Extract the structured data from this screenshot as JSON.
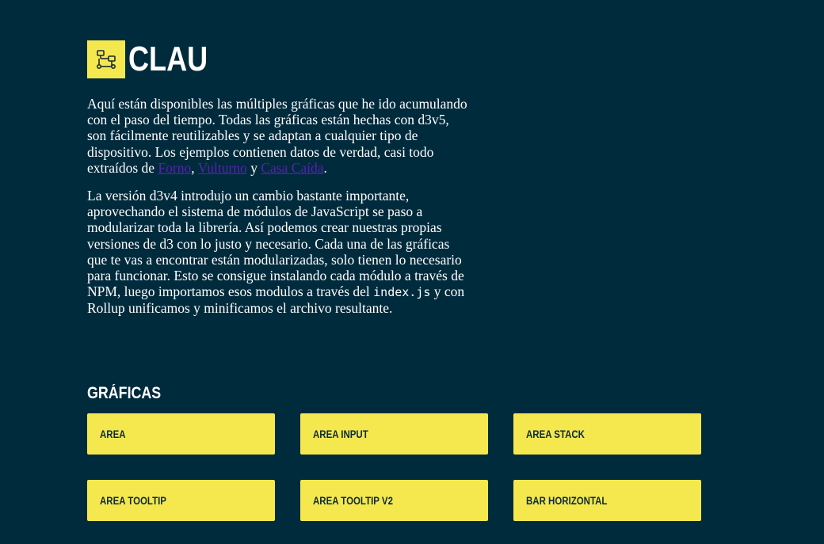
{
  "header": {
    "logo_icon": "flowchart-icon",
    "title": "CLAU"
  },
  "intro": {
    "p1_text": "Aquí están disponibles las múltiples gráficas que he ido acumulando con el paso del tiempo. Todas las gráficas están hechas con d3v5, son fácilmente reutilizables y se adaptan a cualquier tipo de dispositivo. Los ejemplos contienen datos de verdad, casi todo extraídos de ",
    "link_1": "Forno",
    "sep_1": ", ",
    "link_2": "Vulturno",
    "sep_2": " y ",
    "link_3": "Casa Caída",
    "p1_end": ".",
    "p2_text": "La versión d3v4 introdujo un cambio bastante importante, aprovechando el sistema de módulos de JavaScript se paso a modularizar toda la librería. Así podemos crear nuestras propias versiones de d3 con lo justo y necesario. Cada una de las gráficas que te vas a encontrar están modularizadas, solo tienen lo necesario para funcionar. Esto se consigue instalando cada módulo a través de NPM, luego importamos esos modulos a través del ",
    "code": "index.js",
    "p2_end": " y con Rollup unificamos y minificamos el archivo resultante."
  },
  "charts_section": {
    "title": "GRÁFICAS",
    "items": [
      {
        "label": "AREA"
      },
      {
        "label": "AREA INPUT"
      },
      {
        "label": "AREA STACK"
      },
      {
        "label": "AREA TOOLTIP"
      },
      {
        "label": "AREA TOOLTIP V2"
      },
      {
        "label": "BAR HORIZONTAL"
      }
    ]
  },
  "colors": {
    "background": "#002b3d",
    "accent": "#f5e84f",
    "link": "#5a1fb5"
  }
}
